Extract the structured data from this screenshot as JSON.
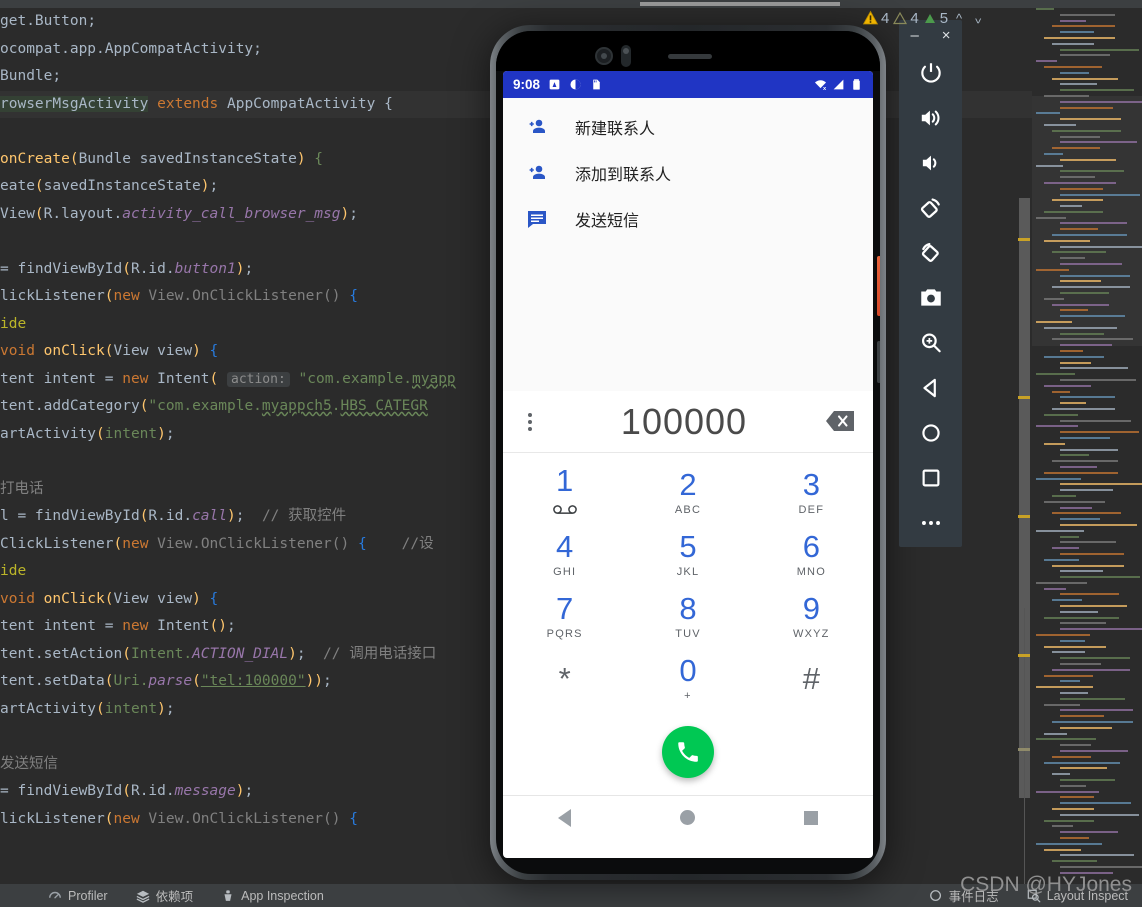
{
  "editor": {
    "lines": [
      {
        "id": "l1",
        "text": "get.Button;"
      },
      {
        "id": "l2",
        "text": "ocompat.app.AppCompatActivity;"
      },
      {
        "id": "l3",
        "text": "Bundle;"
      },
      {
        "id": "l4",
        "text": "rowserMsgActivity extends AppCompatActivity {"
      },
      {
        "id": "l5",
        "text": ""
      },
      {
        "id": "l6",
        "text": "onCreate(Bundle savedInstanceState) {"
      },
      {
        "id": "l7",
        "text": "eate(savedInstanceState);"
      },
      {
        "id": "l8",
        "text": "View(R.layout.activity_call_browser_msg);"
      },
      {
        "id": "l9",
        "text": ""
      },
      {
        "id": "l10",
        "text": "= findViewById(R.id.button1);"
      },
      {
        "id": "l11",
        "text": "lickListener(new View.OnClickListener() {"
      },
      {
        "id": "l12",
        "text": "ide"
      },
      {
        "id": "l13",
        "text": "void onClick(View view) {"
      },
      {
        "id": "l14",
        "text": "tent intent = new Intent( action: \"com.example.myapp"
      },
      {
        "id": "l15",
        "text": "tent.addCategory(\"com.example.myappch5.HBS_CATEGR"
      },
      {
        "id": "l16",
        "text": "artActivity(intent);"
      },
      {
        "id": "l17",
        "text": ""
      },
      {
        "id": "l18",
        "text": "打电话"
      },
      {
        "id": "l19",
        "text": "l = findViewById(R.id.call);  // 获取控件"
      },
      {
        "id": "l20",
        "text": "ClickListener(new View.OnClickListener() {    //设"
      },
      {
        "id": "l21",
        "text": "ide"
      },
      {
        "id": "l22",
        "text": "void onClick(View view) {"
      },
      {
        "id": "l23",
        "text": "tent intent = new Intent();"
      },
      {
        "id": "l24",
        "text": "tent.setAction(Intent.ACTION_DIAL);  // 调用电话接口"
      },
      {
        "id": "l25",
        "text": "tent.setData(Uri.parse(\"tel:100000\"));"
      },
      {
        "id": "l26",
        "text": "artActivity(intent);"
      },
      {
        "id": "l27",
        "text": ""
      },
      {
        "id": "l28",
        "text": "发送短信"
      },
      {
        "id": "l29",
        "text": "= findViewById(R.id.message);"
      },
      {
        "id": "l30",
        "text": "lickListener(new View.OnClickListener() {"
      }
    ],
    "inline_hint": "action:",
    "inspections": {
      "warning_count": "4",
      "weak_warning_count": "4",
      "typo_count": "5"
    }
  },
  "phone": {
    "status_bar": {
      "time": "9:08",
      "icons": [
        "alarm-icon",
        "do-not-disturb-icon",
        "sd-card-icon",
        "wifi-off-icon",
        "signal-icon",
        "battery-icon"
      ]
    },
    "menu": [
      {
        "icon": "person-add-icon",
        "label": "新建联系人"
      },
      {
        "icon": "person-add-icon",
        "label": "添加到联系人"
      },
      {
        "icon": "message-icon",
        "label": "发送短信"
      }
    ],
    "dialer": {
      "number": "100000",
      "overflow_icon": "kebab-menu-icon",
      "backspace_icon": "backspace-icon",
      "keys": [
        [
          {
            "digit": "1",
            "sub": "",
            "vm": true
          },
          {
            "digit": "2",
            "sub": "ABC"
          },
          {
            "digit": "3",
            "sub": "DEF"
          }
        ],
        [
          {
            "digit": "4",
            "sub": "GHI"
          },
          {
            "digit": "5",
            "sub": "JKL"
          },
          {
            "digit": "6",
            "sub": "MNO"
          }
        ],
        [
          {
            "digit": "7",
            "sub": "PQRS"
          },
          {
            "digit": "8",
            "sub": "TUV"
          },
          {
            "digit": "9",
            "sub": "WXYZ"
          }
        ],
        [
          {
            "digit": "*",
            "sub": "",
            "grey": true
          },
          {
            "digit": "0",
            "sub": "+"
          },
          {
            "digit": "#",
            "sub": "",
            "grey": true
          }
        ]
      ],
      "call_button_icon": "phone-call-icon",
      "call_button_color": "#00c853"
    },
    "navbar": [
      "back-icon",
      "home-icon",
      "recents-icon"
    ]
  },
  "emulator_toolbar": {
    "minimize_label": "–",
    "close_label": "×",
    "buttons": [
      {
        "name": "power-icon"
      },
      {
        "name": "volume-up-icon"
      },
      {
        "name": "volume-down-icon"
      },
      {
        "name": "rotate-left-icon"
      },
      {
        "name": "rotate-right-icon"
      },
      {
        "name": "camera-icon"
      },
      {
        "name": "zoom-in-icon"
      },
      {
        "name": "back-icon"
      },
      {
        "name": "home-icon"
      },
      {
        "name": "overview-icon"
      },
      {
        "name": "more-icon"
      }
    ]
  },
  "status_bar": {
    "items": [
      {
        "icon": "profiler-icon",
        "label": "Profiler"
      },
      {
        "icon": "layers-icon",
        "label": "依赖项"
      },
      {
        "icon": "app-inspection-icon",
        "label": "App Inspection"
      }
    ],
    "right_items": [
      {
        "icon": "event-log-icon",
        "label": "事件日志"
      },
      {
        "icon": "layout-inspector-icon",
        "label": "Layout Inspect"
      }
    ]
  },
  "watermark": "CSDN @HYJones"
}
